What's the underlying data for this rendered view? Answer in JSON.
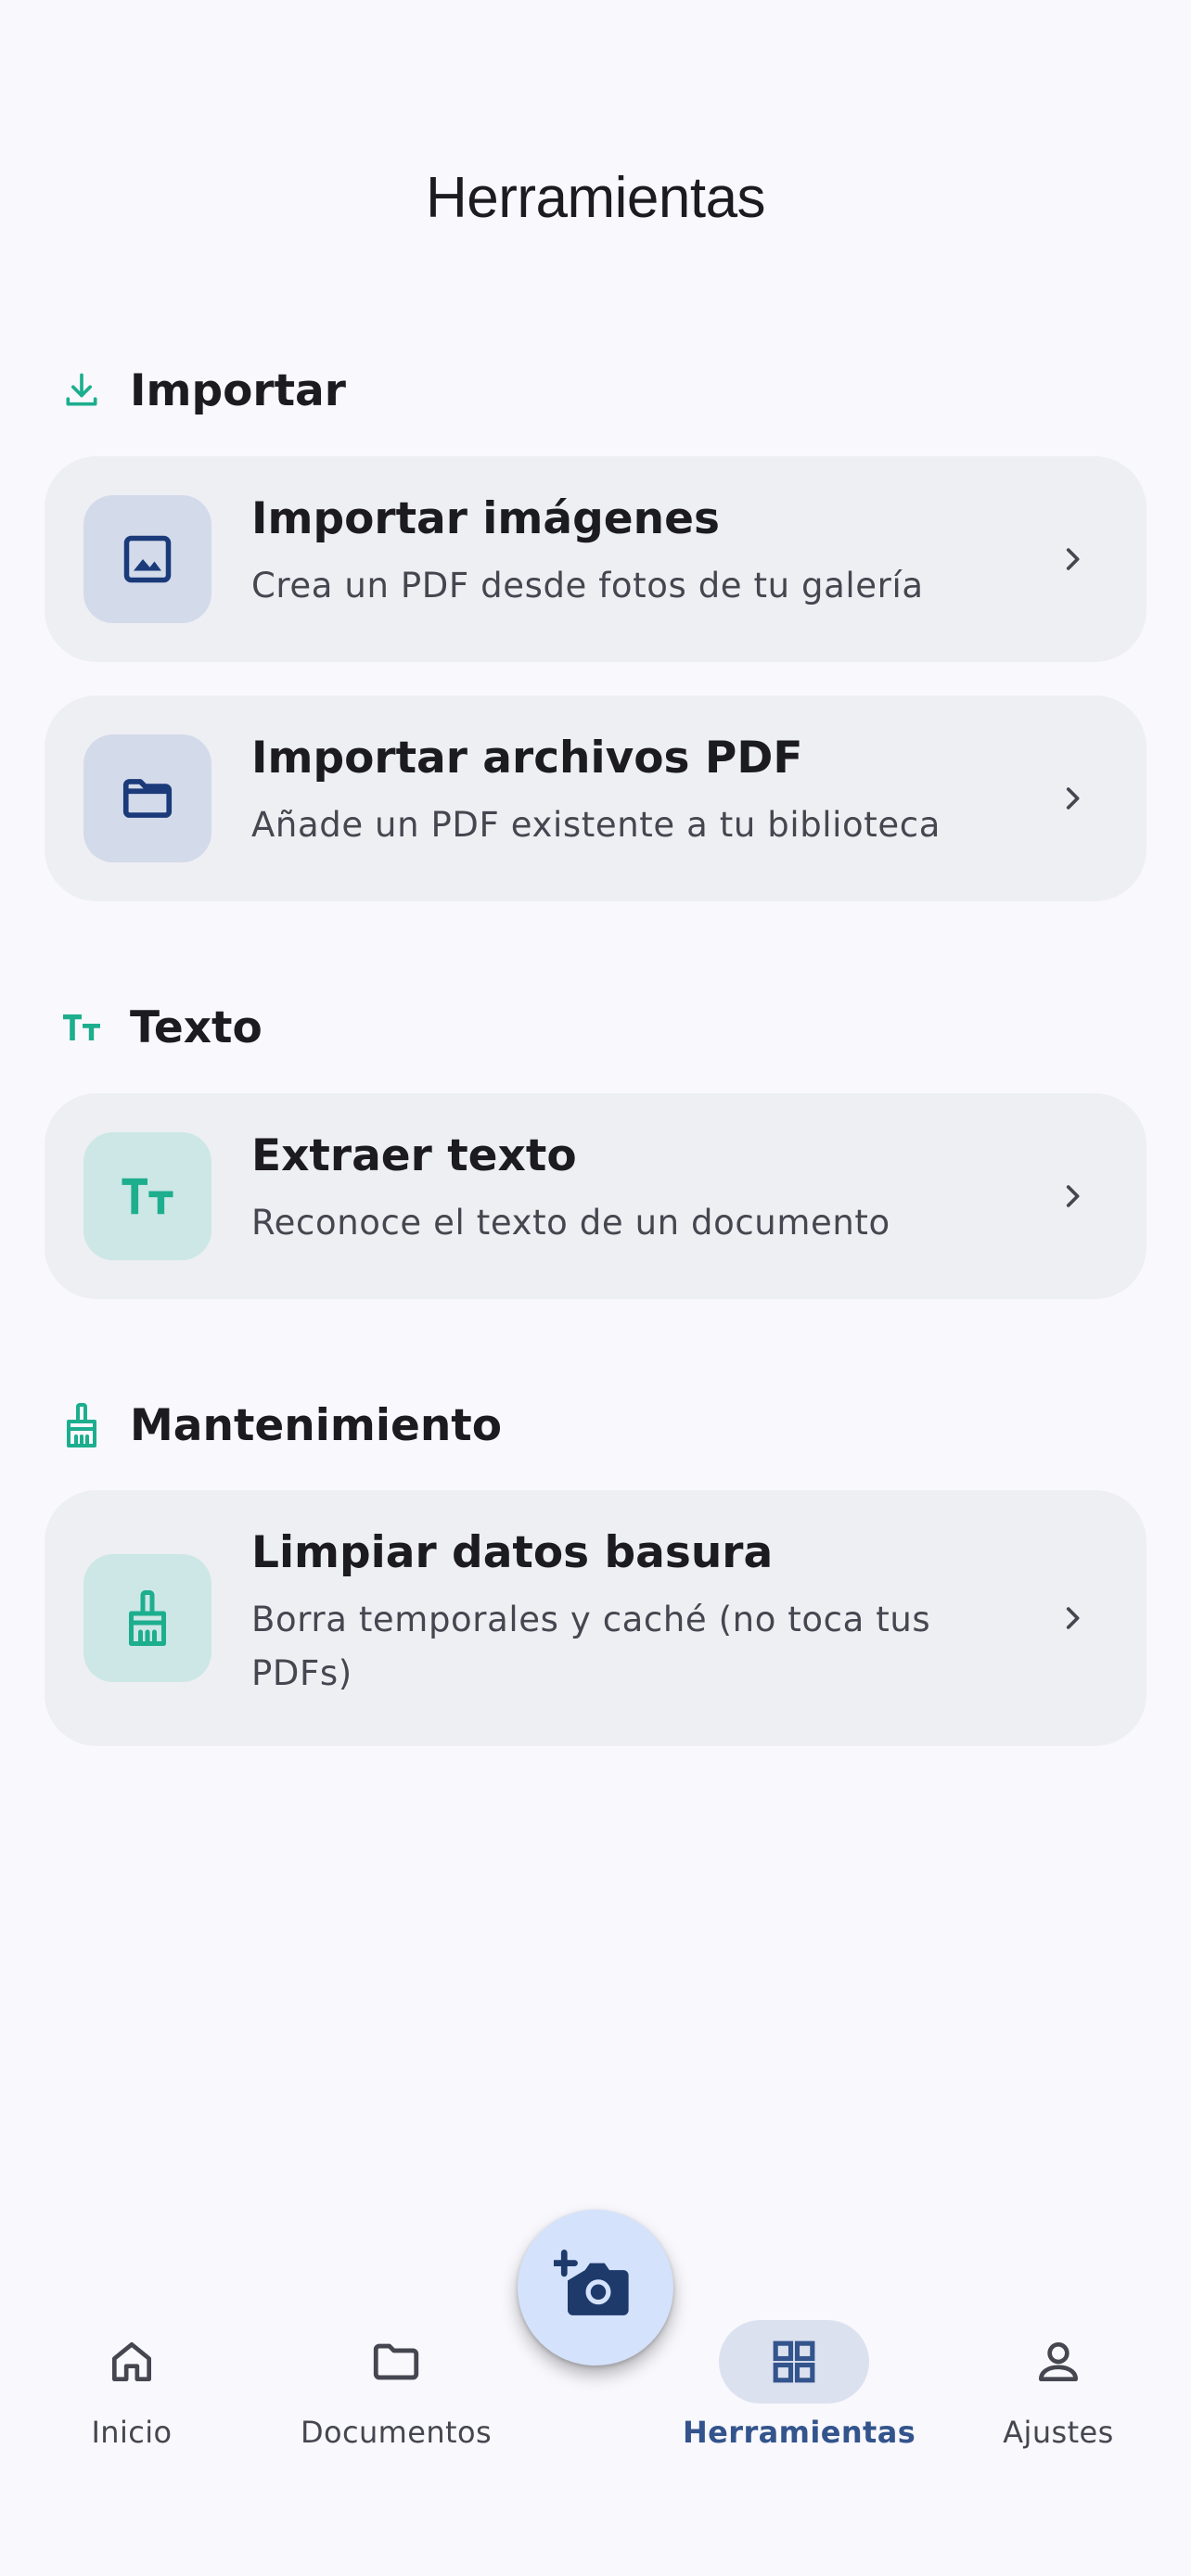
{
  "header": {
    "title": "Herramientas"
  },
  "sections": {
    "importar": {
      "label": "Importar",
      "icon": "download-icon",
      "items": [
        {
          "title": "Importar imágenes",
          "subtitle": "Crea un PDF desde fotos de tu galería",
          "icon": "image-icon"
        },
        {
          "title": "Importar archivos PDF",
          "subtitle": "Añade un PDF existente a tu biblioteca",
          "icon": "folder-icon"
        }
      ]
    },
    "texto": {
      "label": "Texto",
      "icon": "text-size-icon",
      "items": [
        {
          "title": "Extraer texto",
          "subtitle": "Reconoce el texto de un documento",
          "icon": "text-size-icon"
        }
      ]
    },
    "mantenimiento": {
      "label": "Mantenimiento",
      "icon": "broom-icon",
      "items": [
        {
          "title": "Limpiar datos basura",
          "subtitle": "Borra temporales y caché (no toca tus PDFs)",
          "icon": "broom-icon"
        }
      ]
    }
  },
  "fab": {
    "icon": "add-camera-icon"
  },
  "bottom_nav": {
    "items": [
      {
        "label": "Inicio",
        "icon": "home-icon",
        "active": false
      },
      {
        "label": "Documentos",
        "icon": "folder-icon",
        "active": false
      },
      {
        "label": "Herramientas",
        "icon": "grid-icon",
        "active": true
      },
      {
        "label": "Ajustes",
        "icon": "person-icon",
        "active": false
      }
    ]
  },
  "colors": {
    "background": "#F8F8FD",
    "card": "#EEEFF3",
    "accent_teal": "#1DAE8E",
    "accent_navy": "#1A3A7A",
    "active_nav": "#33548C",
    "fab": "#D4E2FB"
  }
}
